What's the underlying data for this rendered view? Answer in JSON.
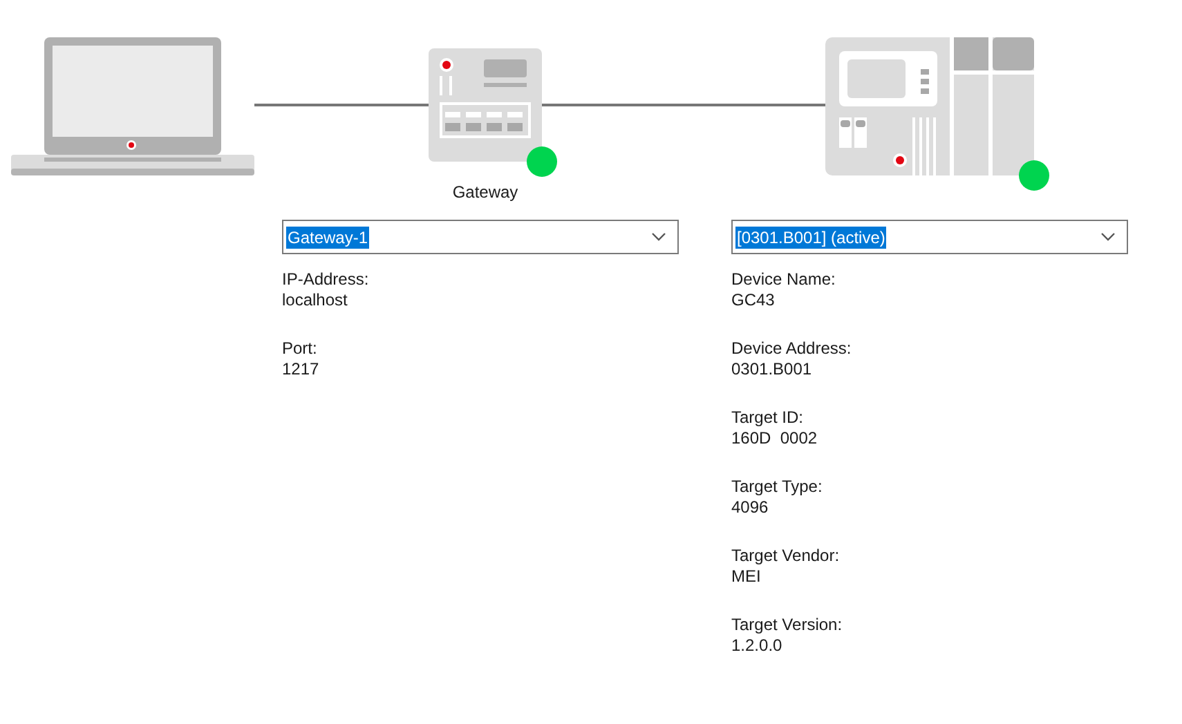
{
  "nodes": [
    {
      "kind": "laptop"
    },
    {
      "kind": "gateway",
      "label": "Gateway",
      "color": "#00d44f"
    },
    {
      "kind": "controller",
      "color": "#00d44f"
    }
  ],
  "panels": [
    {
      "selector": {
        "value": "Gateway-1",
        "text_selected": true
      },
      "fields": [
        {
          "label": "IP-Address:",
          "value": "localhost"
        },
        {
          "label": "Port:",
          "value": "1217"
        }
      ]
    },
    {
      "selector": {
        "value": "[0301.B001] (active)",
        "text_selected": true
      },
      "fields": [
        {
          "label": "Device Name:",
          "value": "GC43"
        },
        {
          "label": "Device Address:",
          "value": "0301.B001"
        },
        {
          "label": "Target ID:",
          "value": "160D  0002"
        },
        {
          "label": "Target Type:",
          "value": "4096"
        },
        {
          "label": "Target Vendor:",
          "value": "MEI"
        },
        {
          "label": "Target Version:",
          "value": "1.2.0.0"
        }
      ]
    }
  ]
}
